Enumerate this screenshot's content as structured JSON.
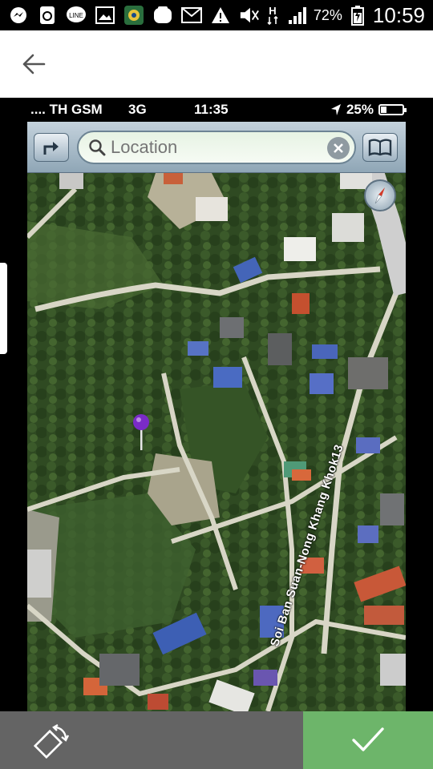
{
  "status_bar": {
    "battery_percent": "72%",
    "time": "10:59",
    "notification_icons": [
      "messenger-icon",
      "recycle-icon",
      "line-icon",
      "gallery-icon",
      "photo-app-icon",
      "camera-app-icon",
      "gmail-icon",
      "warning-icon",
      "mute-icon"
    ],
    "signal_label": "H"
  },
  "app_bar": {
    "back_icon": "arrow-back-icon"
  },
  "embedded_screenshot": {
    "carrier": ".... TH GSM",
    "network": "3G",
    "time": "11:35",
    "battery": "25%",
    "battery_level": 0.25,
    "search_placeholder": "Location",
    "road_label": "Soi Ban Suan-Nong Khang Khok13"
  },
  "bottom_bar": {
    "rotate_icon": "rotate-icon",
    "confirm_icon": "check-icon",
    "rotate_color": "#646464",
    "confirm_color": "#6db56a"
  }
}
